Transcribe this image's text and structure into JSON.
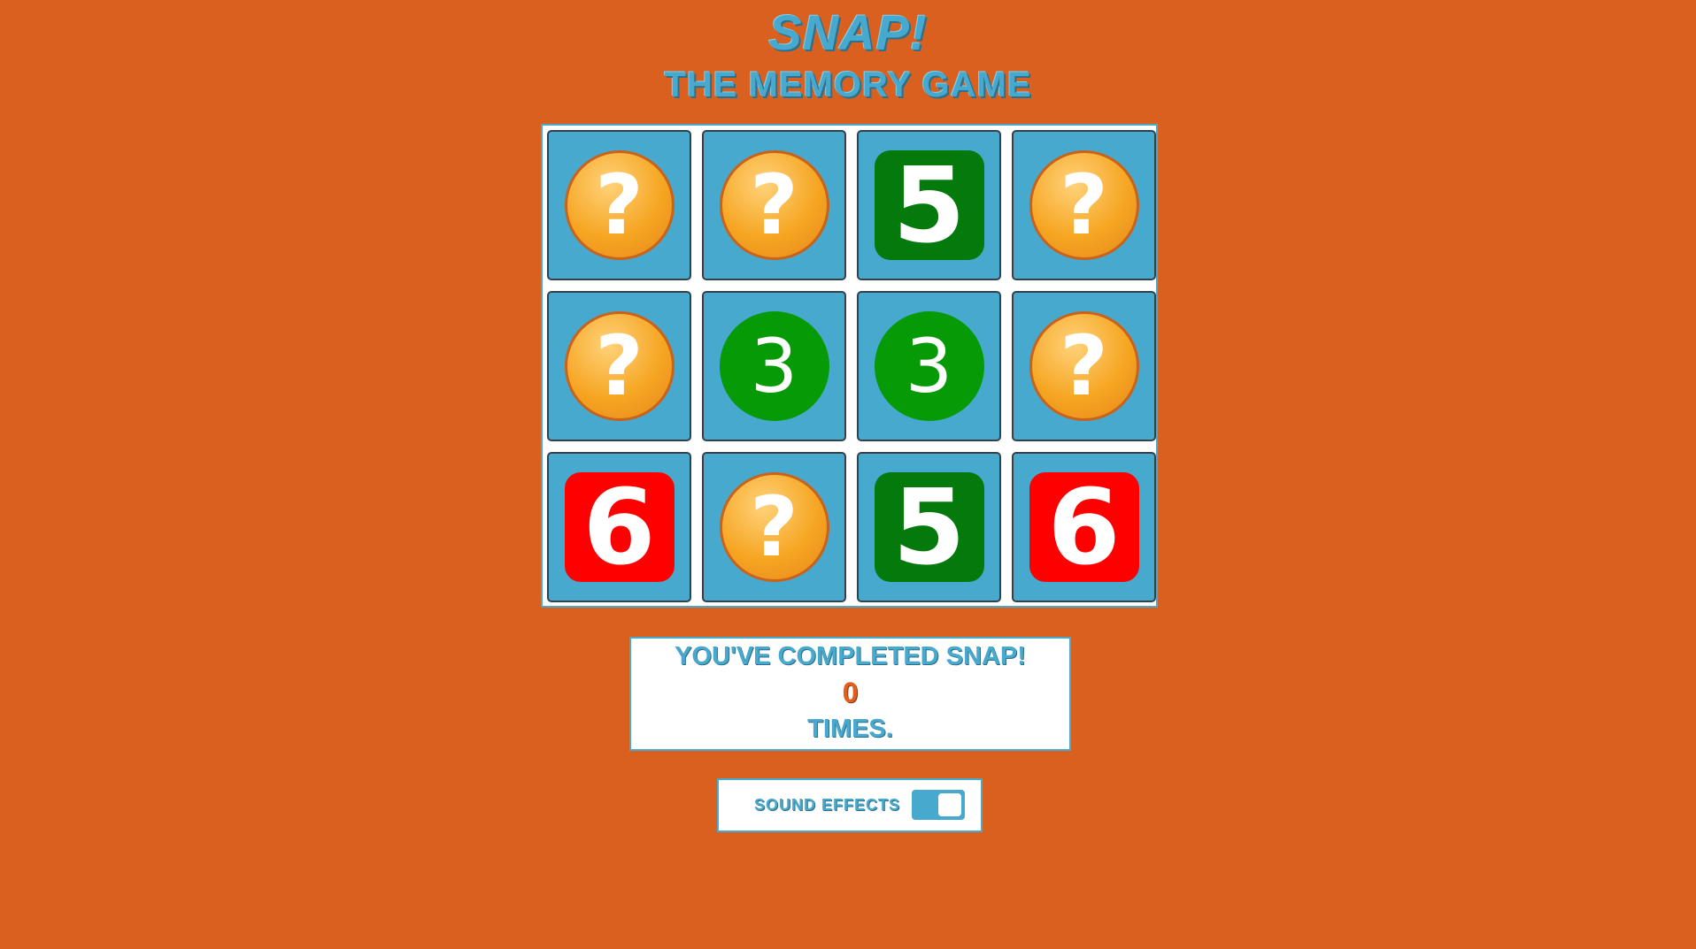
{
  "header": {
    "title": "Snap!",
    "subtitle": "The Memory Game"
  },
  "board": {
    "rows": 3,
    "columns": 4,
    "cards": [
      {
        "state": "hidden",
        "symbol": "?",
        "style": "question-orange"
      },
      {
        "state": "hidden",
        "symbol": "?",
        "style": "question-orange"
      },
      {
        "state": "revealed",
        "symbol": "5",
        "style": "square-green"
      },
      {
        "state": "hidden",
        "symbol": "?",
        "style": "question-orange"
      },
      {
        "state": "hidden",
        "symbol": "?",
        "style": "question-orange"
      },
      {
        "state": "revealed",
        "symbol": "3",
        "style": "circle-green"
      },
      {
        "state": "revealed",
        "symbol": "3",
        "style": "circle-green"
      },
      {
        "state": "hidden",
        "symbol": "?",
        "style": "question-orange"
      },
      {
        "state": "revealed",
        "symbol": "6",
        "style": "square-red"
      },
      {
        "state": "hidden",
        "symbol": "?",
        "style": "question-orange"
      },
      {
        "state": "revealed",
        "symbol": "5",
        "style": "square-green"
      },
      {
        "state": "revealed",
        "symbol": "6",
        "style": "square-red"
      }
    ]
  },
  "stats": {
    "line1": "You've completed Snap!",
    "count": "0",
    "line2": "times."
  },
  "settings": {
    "sound_label": "Sound Effects",
    "sound_enabled": true
  },
  "colors": {
    "background": "#d9601f",
    "accent": "#47a9cd",
    "question": "#f6a623",
    "green_square": "#047a0c",
    "green_circle": "#069a06",
    "red_square": "#ff0000"
  }
}
